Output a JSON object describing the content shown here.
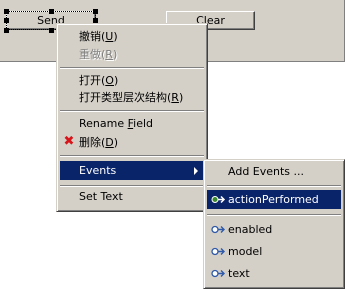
{
  "canvas": {
    "send_label": "Send",
    "clear_label": "Clear"
  },
  "context_menu": {
    "undo": {
      "label": "撤销",
      "key": "U",
      "open": "(",
      "close": ")"
    },
    "redo": {
      "label": "重做",
      "key": "R",
      "open": "(",
      "close": ")"
    },
    "open": {
      "label": "打开",
      "key": "O",
      "open": "(",
      "close": ")"
    },
    "open_type_hierarchy": {
      "label": "打开类型层次结构",
      "key": "R",
      "open": "(",
      "close": ")"
    },
    "rename_field": {
      "label": "Rename ",
      "key": "F",
      "rest": "ield"
    },
    "delete": {
      "label": "删除",
      "key": "D",
      "open": "(",
      "close": ")"
    },
    "events": {
      "label": "Events"
    },
    "set_text": {
      "label": "Set Text"
    }
  },
  "events_submenu": {
    "add_events": "Add Events ...",
    "items": [
      "actionPerformed",
      "enabled",
      "model",
      "text"
    ]
  },
  "colors": {
    "highlight": "#0a246a",
    "menu_bg": "#d4d0c8",
    "delete_icon": "#d8141b",
    "method_icon": "#2f5aa8"
  },
  "icons": {
    "delete": "red-x-icon",
    "method_highlighted": "green-arrow-method-icon",
    "method": "blue-arrow-method-icon"
  }
}
